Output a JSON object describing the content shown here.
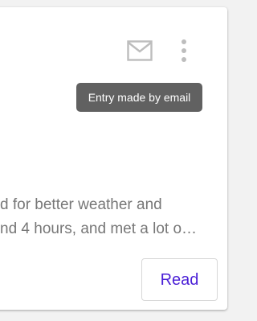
{
  "card": {
    "tooltip": "Entry made by email",
    "excerpt_lines": [
      "d for better weather and",
      "nd 4 hours, and met a lot o…"
    ],
    "read_button": "Read"
  },
  "icons": {
    "mail": "mail-icon",
    "more": "more-vert-icon"
  },
  "colors": {
    "accent": "#4a1fd6",
    "tooltip_bg": "#616161",
    "icon_gray": "#bdbdbd",
    "text_gray": "#777777"
  }
}
